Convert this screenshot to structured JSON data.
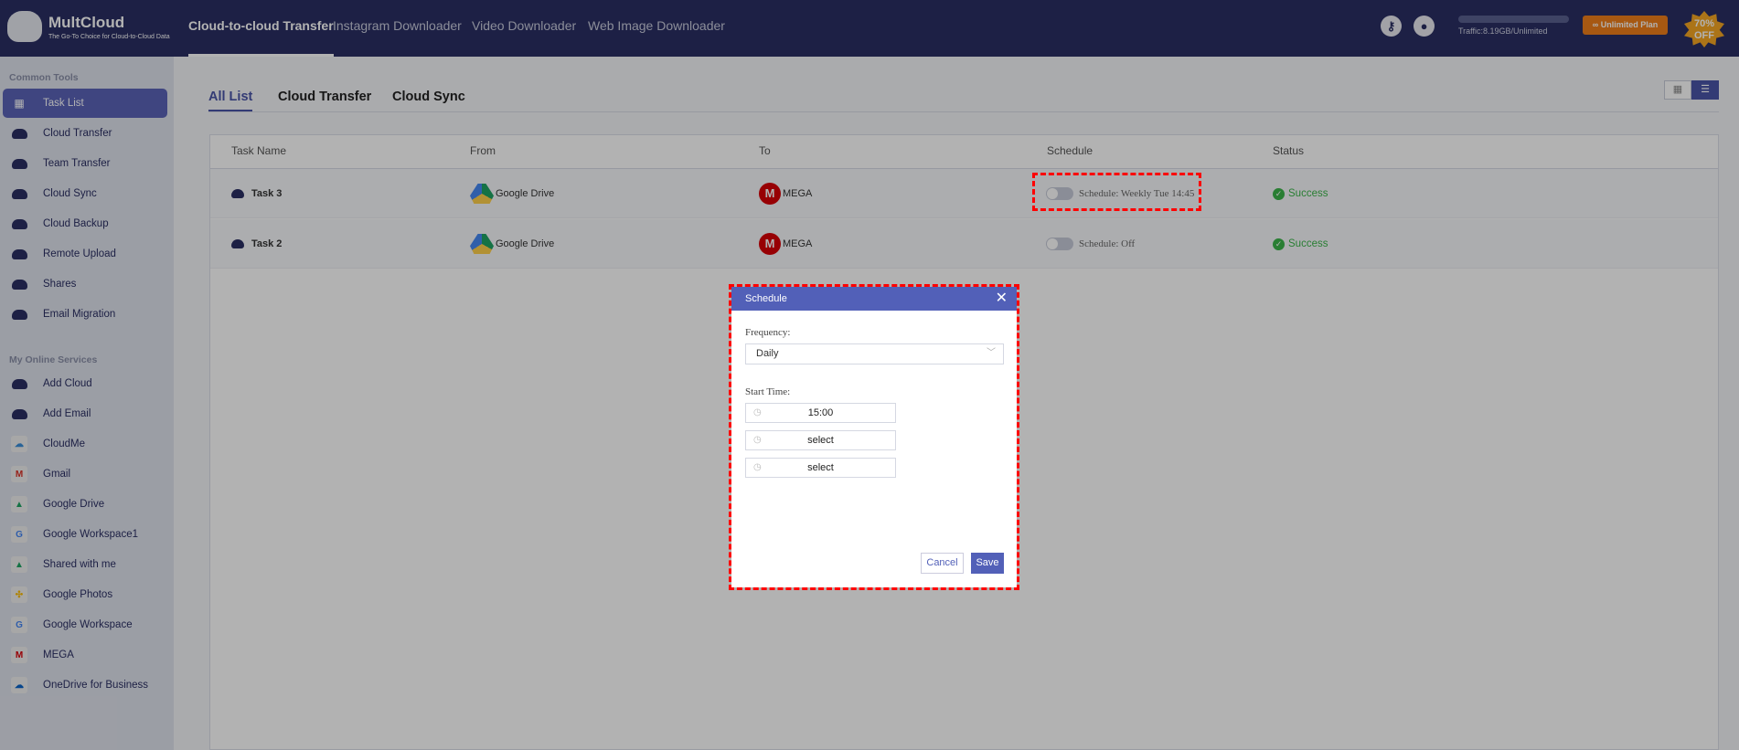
{
  "brand": {
    "name": "MultCloud",
    "tagline": "The Go-To Choice for Cloud-to-Cloud Data"
  },
  "nav": [
    "Cloud-to-cloud Transfer",
    "Instagram Downloader",
    "Video Downloader",
    "Web Image Downloader"
  ],
  "header": {
    "traffic": "Traffic:8.19GB/Unlimited",
    "plan_button": "Unlimited Plan",
    "badge": "70% OFF"
  },
  "sidebar": {
    "common_title": "Common Tools",
    "common": [
      "Task List",
      "Cloud Transfer",
      "Team Transfer",
      "Cloud Sync",
      "Cloud Backup",
      "Remote Upload",
      "Shares",
      "Email Migration"
    ],
    "services_title": "My Online Services",
    "services": [
      "Add Cloud",
      "Add Email",
      "CloudMe",
      "Gmail",
      "Google Drive",
      "Google Workspace1",
      "Shared with me",
      "Google Photos",
      "Google Workspace",
      "MEGA",
      "OneDrive for Business"
    ]
  },
  "tabs": [
    "All List",
    "Cloud Transfer",
    "Cloud Sync"
  ],
  "table": {
    "columns": [
      "Task Name",
      "From",
      "To",
      "Schedule",
      "Status"
    ],
    "rows": [
      {
        "name": "Task 3",
        "from": "Google Drive",
        "to": "MEGA",
        "schedule": "Schedule: Weekly Tue 14:45",
        "status": "Success"
      },
      {
        "name": "Task 2",
        "from": "Google Drive",
        "to": "MEGA",
        "schedule": "Schedule: Off",
        "status": "Success"
      }
    ]
  },
  "dialog": {
    "title": "Schedule",
    "frequency_label": "Frequency:",
    "frequency": "Daily",
    "start_label": "Start Time:",
    "times": [
      "15:00",
      "select",
      "select"
    ],
    "cancel": "Cancel",
    "save": "Save"
  },
  "colors": {
    "topbar": "#2a2f63",
    "accent": "#5260b8",
    "plan": "#f07f1a",
    "success": "#3bb54a",
    "highlight": "#ff0000"
  }
}
